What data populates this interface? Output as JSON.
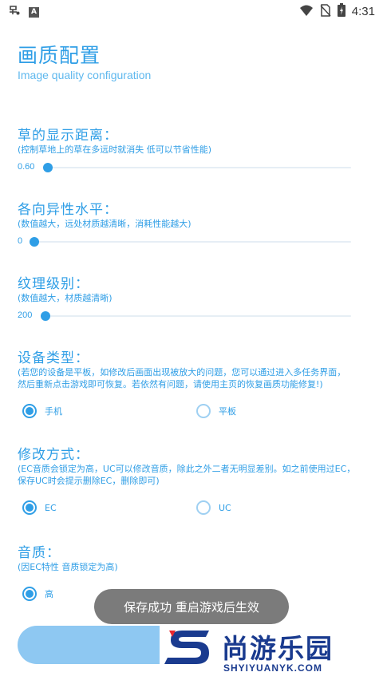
{
  "status_bar": {
    "time": "4:31",
    "left_icons": [
      "notification-icon",
      "a-icon"
    ],
    "right_icons": [
      "wifi-icon",
      "no-sim-icon",
      "battery-icon"
    ]
  },
  "header": {
    "title": "画质配置",
    "subtitle": "Image quality configuration"
  },
  "sections": {
    "grass": {
      "title": "草的显示距离：",
      "desc": "(控制草地上的草在多远时就消失 低可以节省性能)",
      "value": "0.60",
      "level": 0.0
    },
    "aniso": {
      "title": "各向异性水平：",
      "desc": "(数值越大，远处材质越清晰，消耗性能越大)",
      "value": "0",
      "level": 0.0
    },
    "texture": {
      "title": "纹理级别：",
      "desc": "(数值越大，材质越清晰)",
      "value": "200",
      "level": 0.0
    },
    "device": {
      "title": "设备类型：",
      "desc_line1": "(若您的设备是平板，如修改后画面出现被放大的问题，您可以通过进入多任务界面，",
      "desc_line2": "然后重新点击游戏即可恢复。若依然有问题，请使用主页的恢复画质功能修复!)",
      "options": [
        "手机",
        "平板"
      ],
      "selected": "手机"
    },
    "mode": {
      "title": "修改方式：",
      "desc_line1": "(EC音质会锁定为高，UC可以修改音质，除此之外二者无明显差别。如之前使用过EC，",
      "desc_line2": "保存UC时会提示删除EC，删除即可)",
      "options": [
        "EC",
        "UC"
      ],
      "selected": "EC"
    },
    "audio": {
      "title": "音质：",
      "desc": "(因EC特性 音质锁定为高)",
      "options": [
        "高"
      ],
      "selected": "高"
    }
  },
  "toast": {
    "text": "保存成功 重启游戏后生效"
  },
  "watermark": {
    "text": "尚游乐园",
    "sub": "SHYIYUANYK.COM"
  },
  "colors": {
    "accent": "#2f9ee6",
    "accent_light": "#8ec8f2",
    "toast_bg": "#7b7b7b"
  }
}
